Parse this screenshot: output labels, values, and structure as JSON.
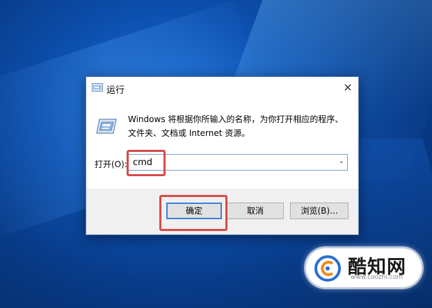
{
  "dialog": {
    "title": "运行",
    "close_label": "×",
    "description": "Windows 将根据你所输入的名称，为你打开相应的程序、文件夹、文档或 Internet 资源。",
    "open_label": "打开(O):",
    "open_value": "cmd",
    "ok_label": "确定",
    "cancel_label": "取消",
    "browse_label": "浏览(B)..."
  },
  "watermark": {
    "name": "酷知网",
    "url": "www.coozhi.com"
  },
  "colors": {
    "highlight": "#d64a4a",
    "accent_border": "#3c7fd8",
    "desktop_blue": "#0c4fae"
  },
  "icons": [
    "run-app-icon",
    "close-icon",
    "dropdown-arrow-icon",
    "coozhi-logo-icon"
  ]
}
